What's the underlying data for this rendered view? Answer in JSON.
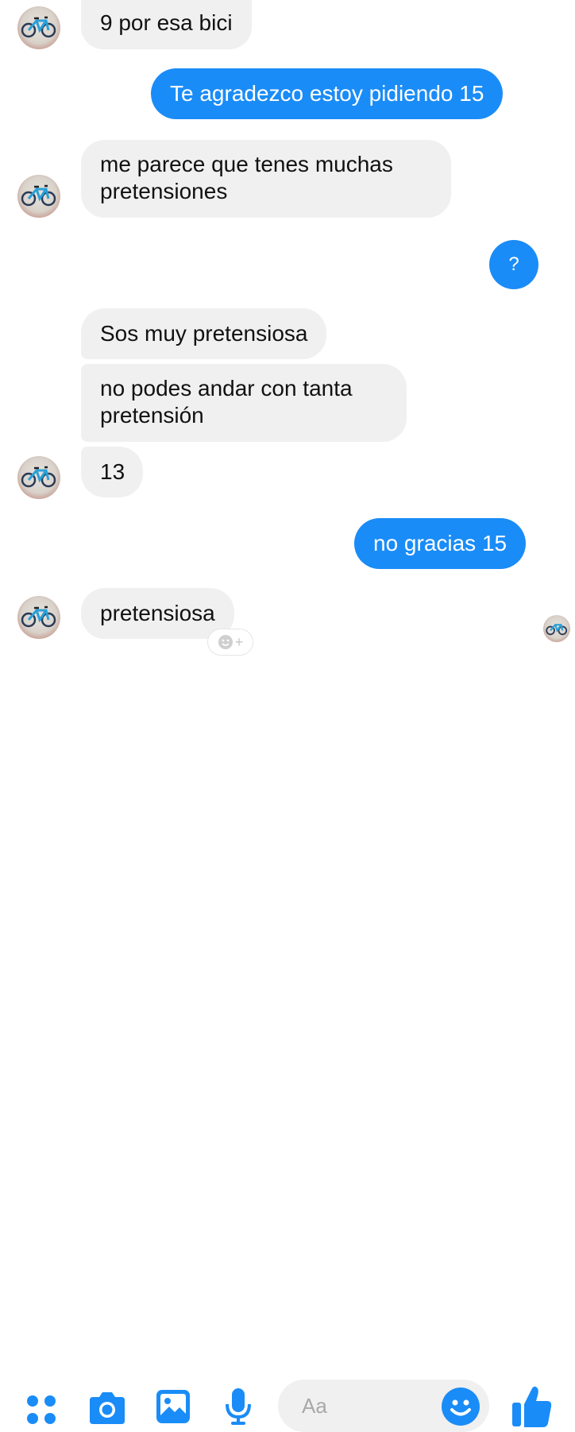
{
  "messages": [
    {
      "side": "in",
      "text": "9 por esa bici",
      "avatar": true
    },
    {
      "side": "out",
      "text": "Te agradezco estoy pidiendo 15"
    },
    {
      "side": "in",
      "lines": [
        "me parece que tenes muchas",
        "pretensiones"
      ],
      "avatar": true
    },
    {
      "side": "out",
      "text": "?"
    },
    {
      "side": "in",
      "text": "Sos muy pretensiosa"
    },
    {
      "side": "in",
      "lines": [
        "no podes andar con tanta",
        "pretensión"
      ]
    },
    {
      "side": "in",
      "text": "13",
      "avatar": true
    },
    {
      "side": "out",
      "text": "no gracias 15"
    },
    {
      "side": "in",
      "text": "pretensiosa",
      "avatar": true
    }
  ],
  "reaction": {
    "plus": "+"
  },
  "composer": {
    "placeholder": "Aa"
  },
  "icons": {
    "menu": "grid-dots-icon",
    "camera": "camera-icon",
    "gallery": "image-icon",
    "mic": "microphone-icon",
    "emoji": "smiley-icon",
    "like": "thumbs-up-icon"
  },
  "colors": {
    "accent": "#1a8cf7",
    "incoming_bubble": "#f1f0f0"
  }
}
